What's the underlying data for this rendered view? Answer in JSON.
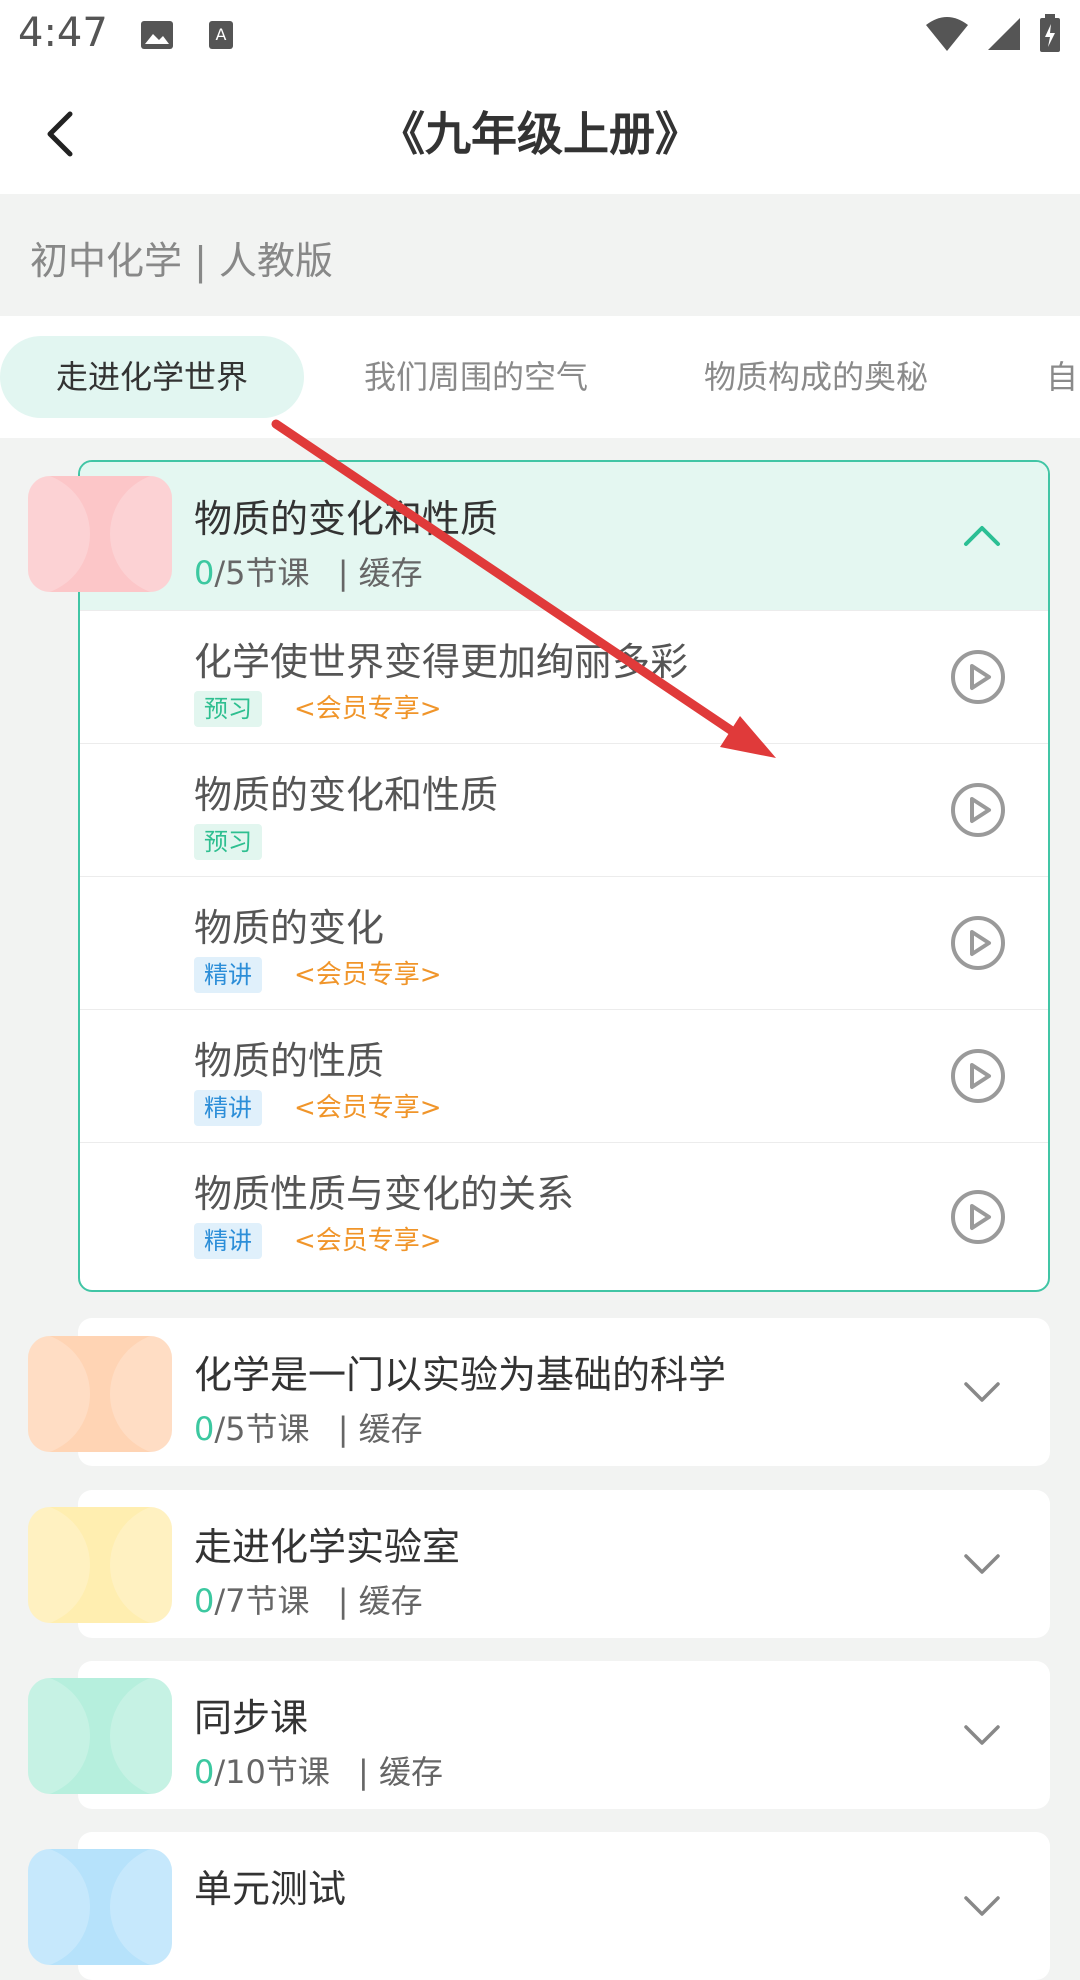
{
  "status": {
    "time": "4:47"
  },
  "header": {
    "title": "《九年级上册》"
  },
  "subject": "初中化学 | 人教版",
  "tabs": [
    "走进化学世界",
    "我们周围的空气",
    "物质构成的奥秘",
    "自"
  ],
  "units": [
    {
      "title": "物质的变化和性质",
      "done": "0",
      "rest": "/5节课",
      "cache": "| 缓存",
      "thumb_color": "#fcc6c8",
      "expanded": true
    },
    {
      "title": "化学是一门以实验为基础的科学",
      "done": "0",
      "rest": "/5节课",
      "cache": "| 缓存",
      "thumb_color": "#ffd4b4"
    },
    {
      "title": "走进化学实验室",
      "done": "0",
      "rest": "/7节课",
      "cache": "| 缓存",
      "thumb_color": "#ffeeb0"
    },
    {
      "title": "同步课",
      "done": "0",
      "rest": "/10节课",
      "cache": "| 缓存",
      "thumb_color": "#b6efdd"
    },
    {
      "title": "单元测试",
      "thumb_color": "#b6e2fb"
    }
  ],
  "lessons": [
    {
      "title": "化学使世界变得更加绚丽多彩",
      "tag": "预习",
      "vip": "<会员专享>"
    },
    {
      "title": "物质的变化和性质",
      "tag": "预习"
    },
    {
      "title": "物质的变化",
      "tag": "精讲",
      "vip": "<会员专享>"
    },
    {
      "title": "物质的性质",
      "tag": "精讲",
      "vip": "<会员专享>"
    },
    {
      "title": "物质性质与变化的关系",
      "tag": "精讲",
      "vip": "<会员专享>"
    }
  ],
  "colors": {
    "accent": "#3cc8a0",
    "vip": "#f0952a",
    "annotation_arrow": "#e03a3a"
  }
}
